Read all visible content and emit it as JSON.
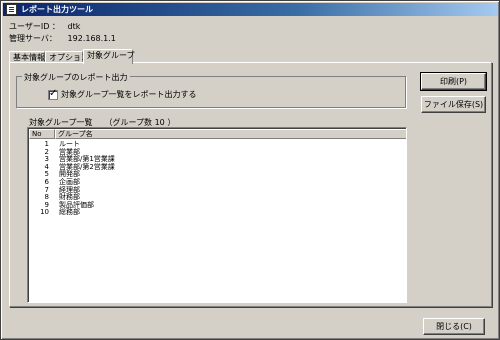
{
  "window": {
    "title": "レポート出力ツール"
  },
  "info": {
    "user_label": "ユーザーID ：",
    "user_value": "dtk",
    "server_label": "管理サーバ：",
    "server_value": "192.168.1.1"
  },
  "tabs": [
    {
      "label": "基本情報"
    },
    {
      "label": "オプション"
    },
    {
      "label": "対象グループ"
    }
  ],
  "output_group": {
    "title": "対象グループのレポート出力",
    "checkbox_label": "対象グループ一覧をレポート出力する",
    "checked": true
  },
  "list": {
    "caption": "対象グループ一覧",
    "count_text": "（グループ数 10 ）",
    "columns": [
      "No",
      "グループ名"
    ],
    "rows": [
      {
        "no": "1",
        "name": "ルート"
      },
      {
        "no": "2",
        "name": "営業部"
      },
      {
        "no": "3",
        "name": "営業部/第1営業課"
      },
      {
        "no": "4",
        "name": "営業部/第2営業課"
      },
      {
        "no": "5",
        "name": "開発部"
      },
      {
        "no": "6",
        "name": "企画部"
      },
      {
        "no": "7",
        "name": "経理部"
      },
      {
        "no": "8",
        "name": "財務部"
      },
      {
        "no": "9",
        "name": "製品評価部"
      },
      {
        "no": "10",
        "name": "総務部"
      }
    ]
  },
  "buttons": {
    "print": "印刷(P)",
    "save": "ファイル保存(S)",
    "close": "閉じる(C)"
  }
}
